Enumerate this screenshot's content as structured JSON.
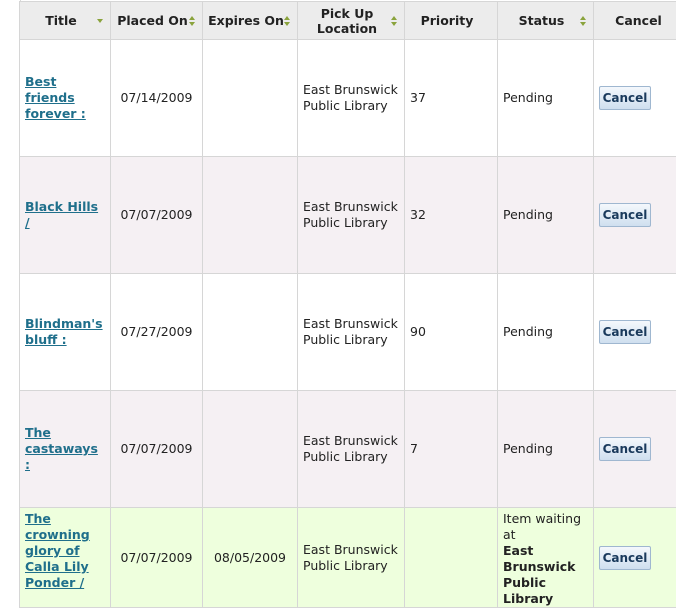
{
  "columns": [
    {
      "label": "Title",
      "sort": "desc"
    },
    {
      "label": "Placed On",
      "sort": "both"
    },
    {
      "label": "Expires On",
      "sort": "both"
    },
    {
      "label": "Pick Up Location",
      "sort": "both"
    },
    {
      "label": "Priority",
      "sort": "none"
    },
    {
      "label": "Status",
      "sort": "both"
    },
    {
      "label": "Cancel",
      "sort": "both"
    }
  ],
  "rows": [
    {
      "title": "Best friends forever :",
      "placed": "07/14/2009",
      "expires": "",
      "location": "East Brunswick Public Library",
      "priority": "37",
      "status": "Pending",
      "cancel": "Cancel"
    },
    {
      "title": "Black Hills /",
      "placed": "07/07/2009",
      "expires": "",
      "location": "East Brunswick Public Library",
      "priority": "32",
      "status": "Pending",
      "cancel": "Cancel"
    },
    {
      "title": "Blindman's bluff :",
      "placed": "07/27/2009",
      "expires": "",
      "location": "East Brunswick Public Library",
      "priority": "90",
      "status": "Pending",
      "cancel": "Cancel"
    },
    {
      "title": "The castaways :",
      "placed": "07/07/2009",
      "expires": "",
      "location": "East Brunswick Public Library",
      "priority": "7",
      "status": "Pending",
      "cancel": "Cancel"
    },
    {
      "title": "The crowning glory of Calla Lily Ponder /",
      "placed": "07/07/2009",
      "expires": "08/05/2009",
      "location": "East Brunswick Public Library",
      "priority": "",
      "status": "Item waiting at",
      "status_location": "East Brunswick Public Library",
      "cancel": "Cancel"
    }
  ],
  "colors": {
    "link": "#1f6f8b",
    "sort_arrow": "#8aa33c",
    "row_alt": "#f5f0f3",
    "row_ready": "#eeffdd"
  }
}
